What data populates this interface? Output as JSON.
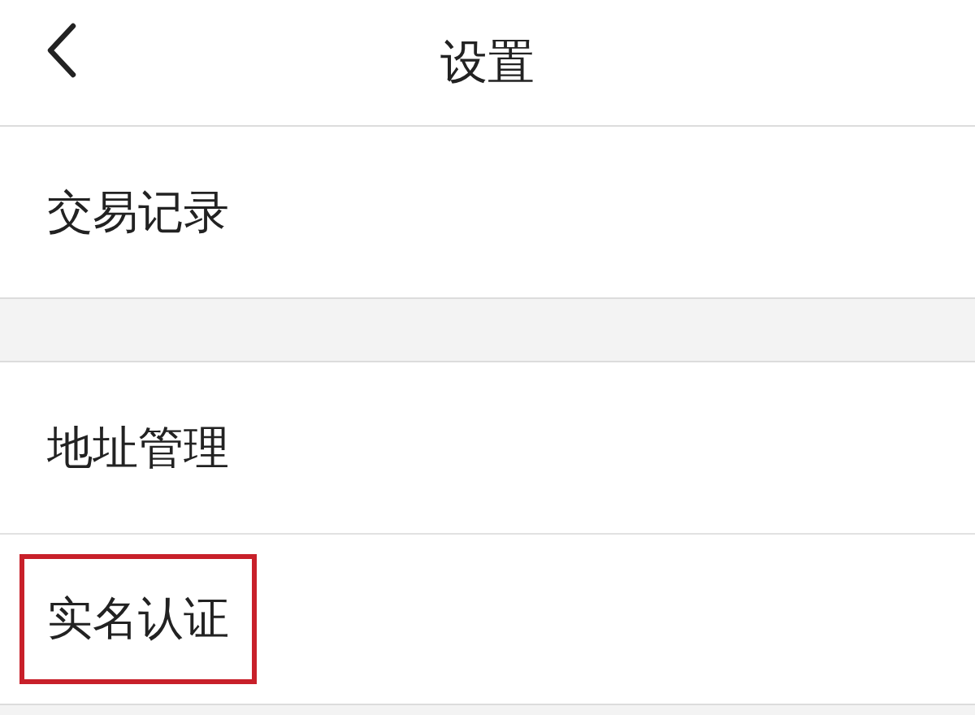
{
  "header": {
    "title": "设置"
  },
  "groups": [
    {
      "items": [
        {
          "label": "交易记录",
          "highlighted": false
        }
      ]
    },
    {
      "items": [
        {
          "label": "地址管理",
          "highlighted": false
        },
        {
          "label": "实名认证",
          "highlighted": true
        }
      ]
    }
  ]
}
